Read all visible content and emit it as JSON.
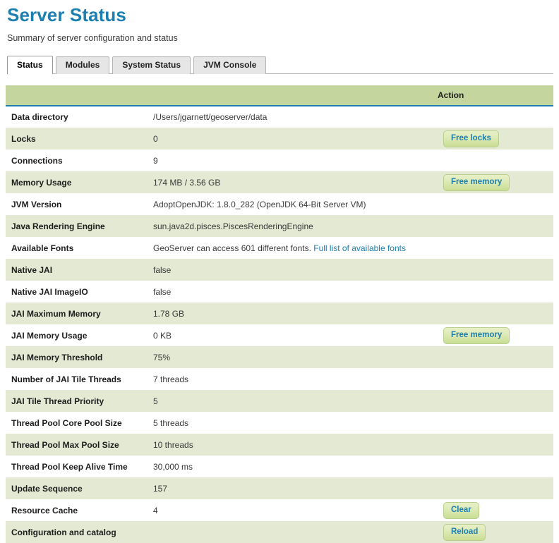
{
  "header": {
    "title": "Server Status",
    "subtitle": "Summary of server configuration and status",
    "title_color": "#1d7eb0"
  },
  "tabs": [
    {
      "label": "Status",
      "active": true
    },
    {
      "label": "Modules",
      "active": false
    },
    {
      "label": "System Status",
      "active": false
    },
    {
      "label": "JVM Console",
      "active": false
    }
  ],
  "table": {
    "columns": {
      "property": "",
      "value": "",
      "action": "Action"
    },
    "rows": [
      {
        "property": "Data directory",
        "value": "/Users/jgarnett/geoserver/data",
        "action": ""
      },
      {
        "property": "Locks",
        "value": "0",
        "action": "Free locks"
      },
      {
        "property": "Connections",
        "value": "9",
        "action": ""
      },
      {
        "property": "Memory Usage",
        "value": "174 MB / 3.56 GB",
        "action": "Free memory"
      },
      {
        "property": "JVM Version",
        "value": "AdoptOpenJDK: 1.8.0_282 (OpenJDK 64-Bit Server VM)",
        "action": ""
      },
      {
        "property": "Java Rendering Engine",
        "value": "sun.java2d.pisces.PiscesRenderingEngine",
        "action": ""
      },
      {
        "property": "Available Fonts",
        "value": "GeoServer can access 601 different fonts.",
        "link": "Full list of available fonts",
        "action": ""
      },
      {
        "property": "Native JAI",
        "value": "false",
        "action": ""
      },
      {
        "property": "Native JAI ImageIO",
        "value": "false",
        "action": ""
      },
      {
        "property": "JAI Maximum Memory",
        "value": "1.78 GB",
        "action": ""
      },
      {
        "property": "JAI Memory Usage",
        "value": "0 KB",
        "action": "Free memory"
      },
      {
        "property": "JAI Memory Threshold",
        "value": "75%",
        "action": ""
      },
      {
        "property": "Number of JAI Tile Threads",
        "value": "7 threads",
        "action": ""
      },
      {
        "property": "JAI Tile Thread Priority",
        "value": "5",
        "action": ""
      },
      {
        "property": "Thread Pool Core Pool Size",
        "value": "5 threads",
        "action": ""
      },
      {
        "property": "Thread Pool Max Pool Size",
        "value": "10 threads",
        "action": ""
      },
      {
        "property": "Thread Pool Keep Alive Time",
        "value": "30,000 ms",
        "action": ""
      },
      {
        "property": "Update Sequence",
        "value": "157",
        "action": ""
      },
      {
        "property": "Resource Cache",
        "value": "4",
        "action": "Clear"
      },
      {
        "property": "Configuration and catalog",
        "value": "",
        "action": "Reload"
      }
    ]
  },
  "colors": {
    "accent_blue": "#1d7eb0",
    "header_green": "#c4d69d",
    "row_green": "#e3e9d2",
    "button_green": "#c8dd93"
  }
}
